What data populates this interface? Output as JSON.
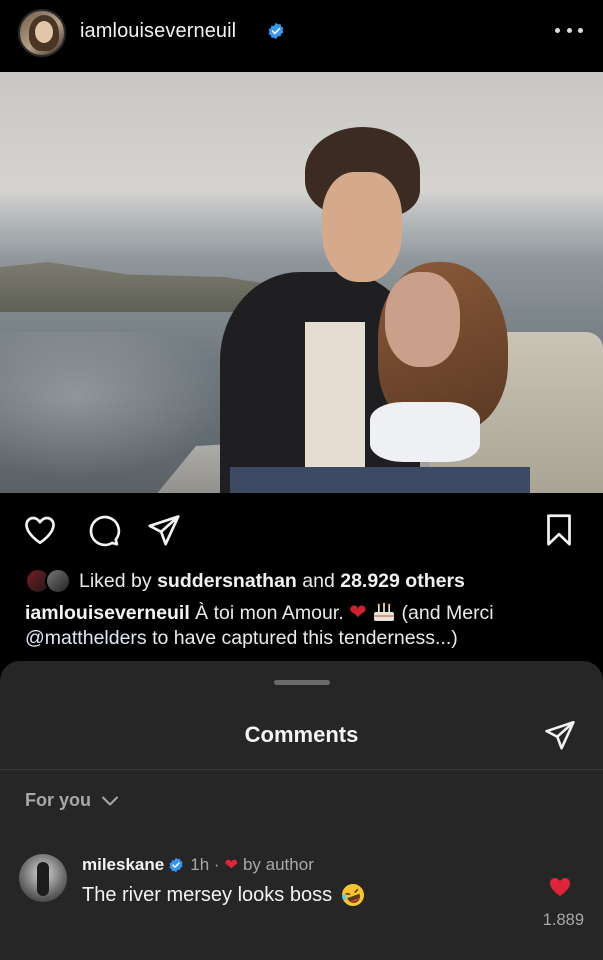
{
  "post": {
    "username": "iamlouiseverneuil",
    "verified": true
  },
  "likes": {
    "prefix": "Liked by",
    "user": "suddersnathan",
    "and": "and",
    "others": "28.929 others"
  },
  "caption": {
    "username": "iamlouiseverneuil",
    "text_start": "À toi mon Amour.",
    "text_paren": "(and Merci",
    "mention": "@matthelders",
    "text_end": "to have captured this tenderness...)"
  },
  "comments_sheet": {
    "title": "Comments",
    "filter_label": "For you",
    "items": [
      {
        "username": "mileskane",
        "verified": true,
        "time": "1h",
        "separator": "·",
        "liked_by": "by author",
        "text": "The river mersey looks boss",
        "like_count": "1.889"
      }
    ]
  },
  "colors": {
    "background": "#000000",
    "sheet": "#262626",
    "verified_blue": "#3897f0",
    "heart_red": "#e0243a",
    "muted_text": "#a8a8a8"
  },
  "icons": [
    "more-icon",
    "heart-icon",
    "comment-icon",
    "share-icon",
    "save-icon",
    "verified-icon",
    "chevron-down-icon",
    "laughing-emoji-icon",
    "cake-emoji-icon"
  ]
}
